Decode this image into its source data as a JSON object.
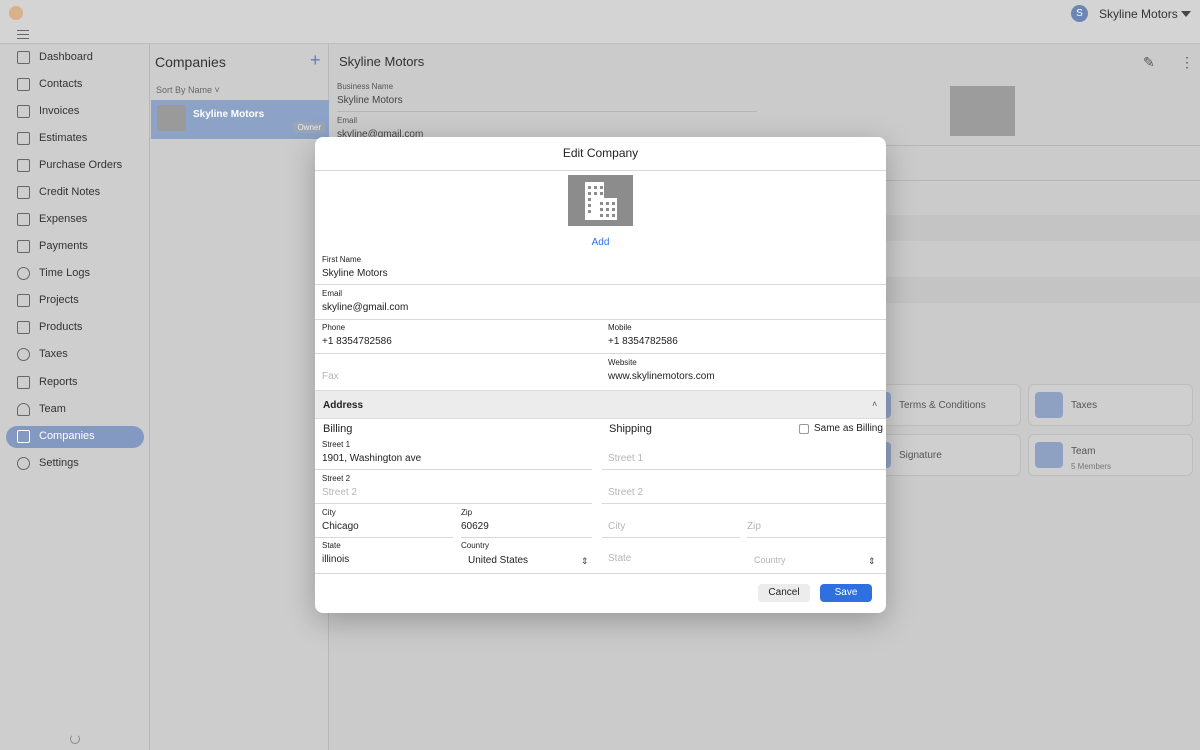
{
  "header": {
    "user_initial": "S",
    "user_name": "Skyline Motors"
  },
  "sidebar": {
    "items": [
      {
        "label": "Dashboard",
        "icon": "home-icon"
      },
      {
        "label": "Contacts",
        "icon": "contacts-icon"
      },
      {
        "label": "Invoices",
        "icon": "invoice-icon"
      },
      {
        "label": "Estimates",
        "icon": "estimate-icon"
      },
      {
        "label": "Purchase Orders",
        "icon": "cart-icon"
      },
      {
        "label": "Credit Notes",
        "icon": "credit-note-icon"
      },
      {
        "label": "Expenses",
        "icon": "wallet-icon"
      },
      {
        "label": "Payments",
        "icon": "payment-icon"
      },
      {
        "label": "Time Logs",
        "icon": "clock-icon"
      },
      {
        "label": "Projects",
        "icon": "folder-icon"
      },
      {
        "label": "Products",
        "icon": "box-icon"
      },
      {
        "label": "Taxes",
        "icon": "percent-icon"
      },
      {
        "label": "Reports",
        "icon": "chart-icon"
      },
      {
        "label": "Team",
        "icon": "team-icon"
      },
      {
        "label": "Companies",
        "icon": "building-icon",
        "active": true
      },
      {
        "label": "Settings",
        "icon": "gear-icon"
      }
    ],
    "accent_color": "#8499c1"
  },
  "companies": {
    "title": "Companies",
    "add_symbol": "+",
    "sort_label": "Sort By Name ˅",
    "rows": [
      {
        "name": "Skyline Motors",
        "badge": "Owner"
      }
    ]
  },
  "detail": {
    "title": "Skyline Motors",
    "business_name_label": "Business Name",
    "business_name_value": "Skyline Motors",
    "email_label": "Email",
    "email_value": "skyline@gmail.com",
    "tiles": [
      {
        "label": "Terms & Conditions",
        "sub": ""
      },
      {
        "label": "Taxes",
        "sub": ""
      },
      {
        "label": "Signature",
        "sub": ""
      },
      {
        "label": "Team",
        "sub": "5 Members"
      }
    ]
  },
  "modal": {
    "title": "Edit Company",
    "add_label": "Add",
    "first_name_label": "First Name",
    "first_name_value": "Skyline Motors",
    "email_label": "Email",
    "email_value": "skyline@gmail.com",
    "phone_label": "Phone",
    "phone_value": "+1 8354782586",
    "mobile_label": "Mobile",
    "mobile_value": "+1 8354782586",
    "fax_placeholder": "Fax",
    "website_label": "Website",
    "website_value": "www.skylinemotors.com",
    "address_title": "Address",
    "billing": {
      "heading": "Billing",
      "street1_label": "Street 1",
      "street1_value": "1901, Washington ave",
      "street2_label": "Street 2",
      "street2_placeholder": "Street 2",
      "city_label": "City",
      "city_value": "Chicago",
      "zip_label": "Zip",
      "zip_value": "60629",
      "state_label": "State",
      "state_value": "illinois",
      "country_label": "Country",
      "country_value": "United States"
    },
    "shipping": {
      "heading": "Shipping",
      "same_as_billing": "Same as Billing",
      "street1_placeholder": "Street 1",
      "street2_placeholder": "Street 2",
      "city_placeholder": "City",
      "zip_placeholder": "Zip",
      "state_placeholder": "State",
      "country_placeholder": "Country"
    },
    "cancel_label": "Cancel",
    "save_label": "Save",
    "save_color": "#2f6fe0"
  }
}
